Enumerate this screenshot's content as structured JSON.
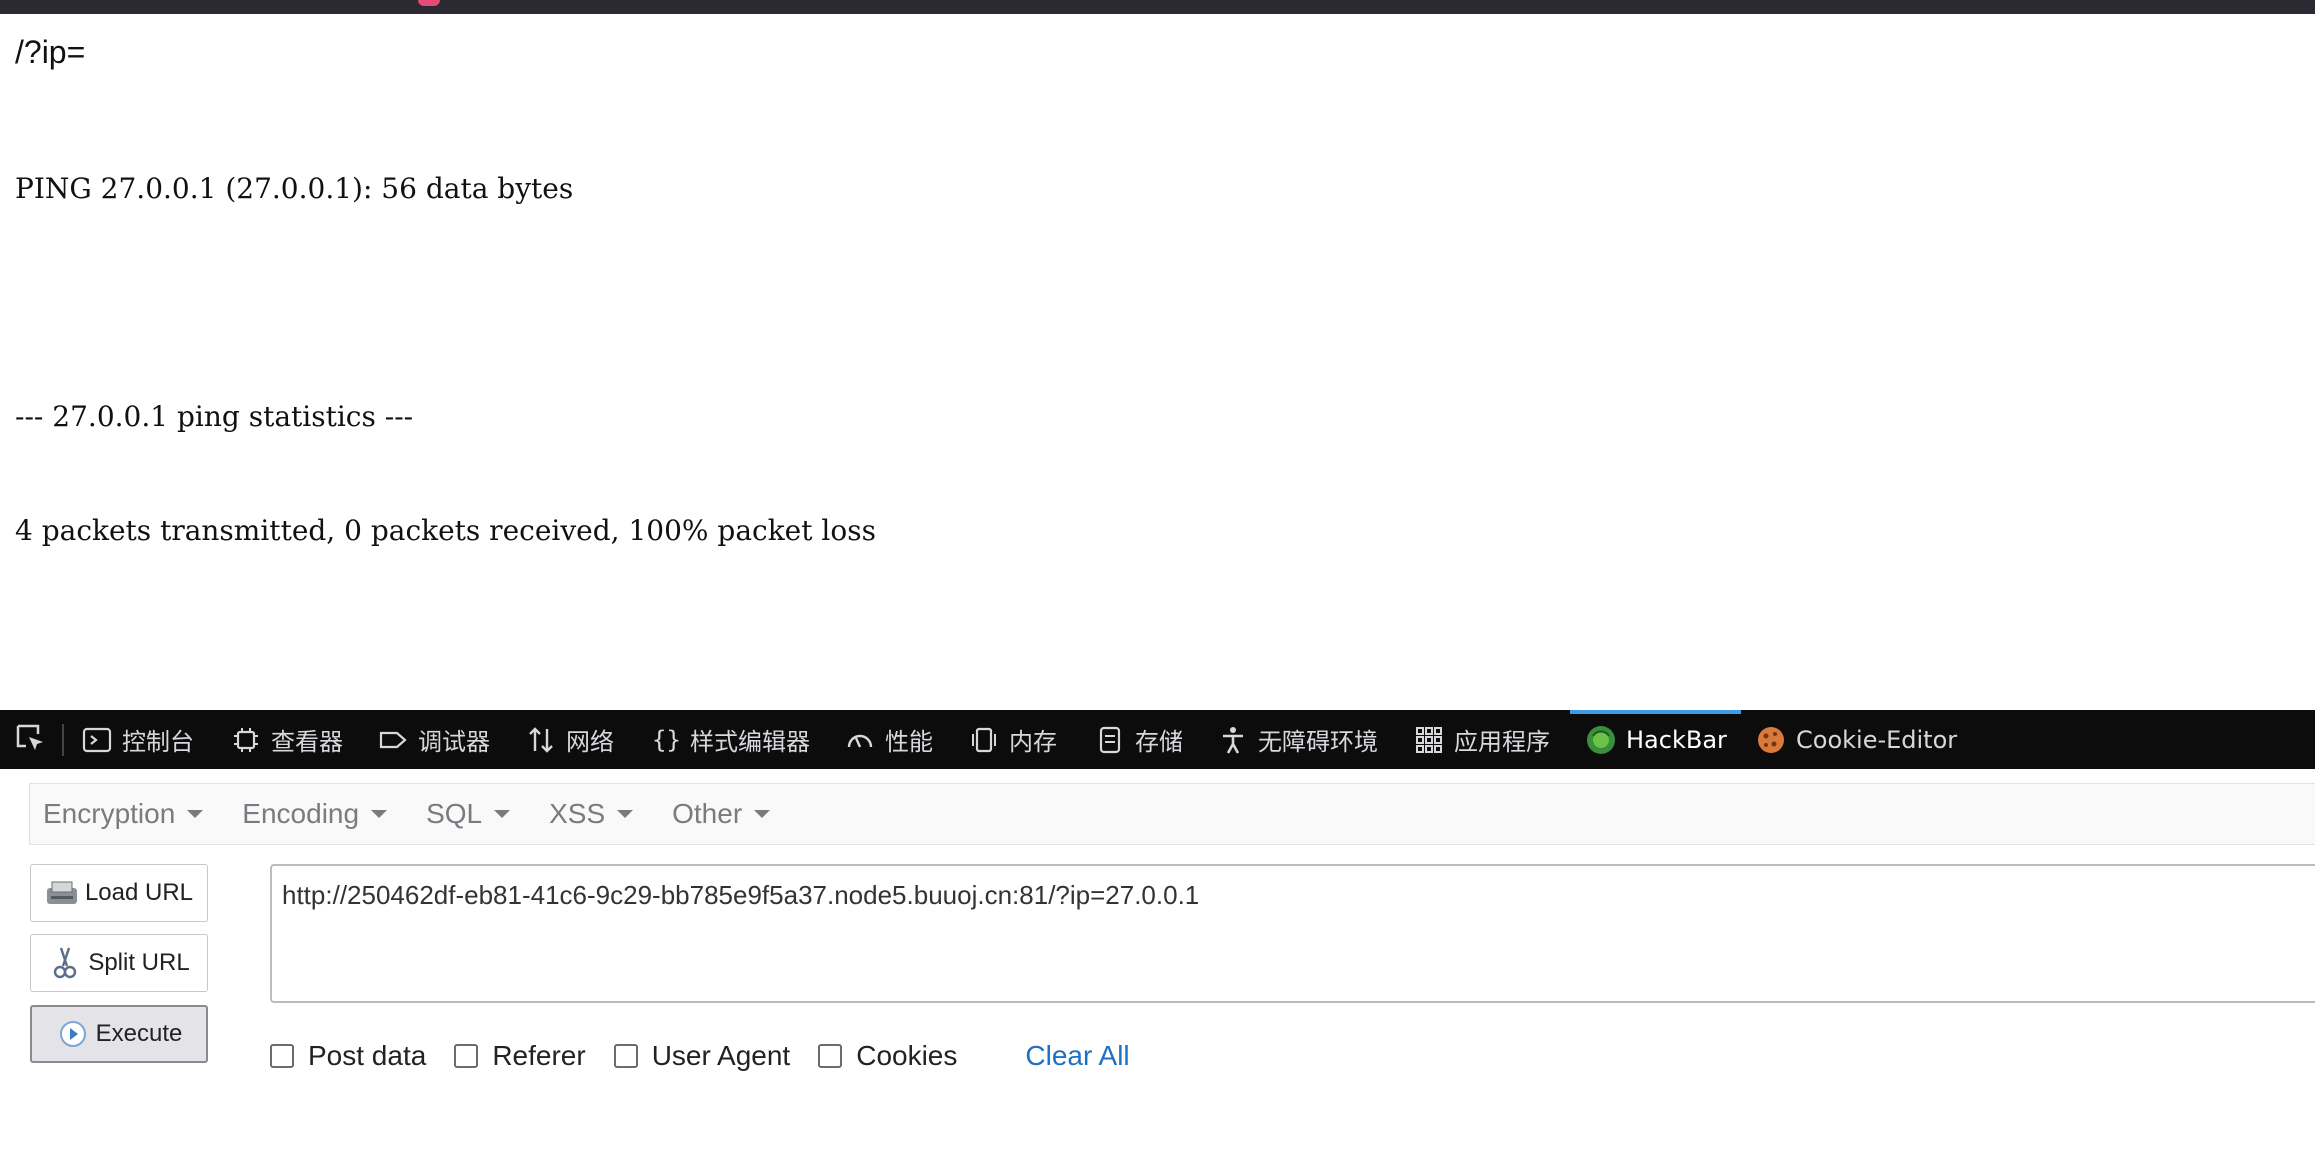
{
  "page": {
    "heading": "/?ip=",
    "output_lines": [
      "PING 27.0.0.1 (27.0.0.1): 56 data bytes",
      "",
      "--- 27.0.0.1 ping statistics ---",
      "4 packets transmitted, 0 packets received, 100% packet loss"
    ]
  },
  "devtools": {
    "tabs": [
      {
        "label": "控制台",
        "icon": "console-icon"
      },
      {
        "label": "查看器",
        "icon": "inspector-icon"
      },
      {
        "label": "调试器",
        "icon": "debugger-icon"
      },
      {
        "label": "网络",
        "icon": "network-icon"
      },
      {
        "label": "样式编辑器",
        "icon": "style-editor-icon"
      },
      {
        "label": "性能",
        "icon": "performance-icon"
      },
      {
        "label": "内存",
        "icon": "memory-icon"
      },
      {
        "label": "存储",
        "icon": "storage-icon"
      },
      {
        "label": "无障碍环境",
        "icon": "accessibility-icon"
      },
      {
        "label": "应用程序",
        "icon": "application-icon"
      },
      {
        "label": "HackBar",
        "icon": "hackbar-icon",
        "active": true
      },
      {
        "label": "Cookie-Editor",
        "icon": "cookie-icon"
      }
    ],
    "active_color": "#3d9ae8"
  },
  "hackbar": {
    "menus": [
      "Encryption",
      "Encoding",
      "SQL",
      "XSS",
      "Other"
    ],
    "buttons": {
      "load": "Load URL",
      "split": "Split URL",
      "execute": "Execute"
    },
    "url": "http://250462df-eb81-41c6-9c29-bb785e9f5a37.node5.buuoj.cn:81/?ip=27.0.0.1",
    "options": [
      "Post data",
      "Referer",
      "User Agent",
      "Cookies"
    ],
    "clear_all": "Clear All",
    "link_color": "#1f6fc5"
  }
}
